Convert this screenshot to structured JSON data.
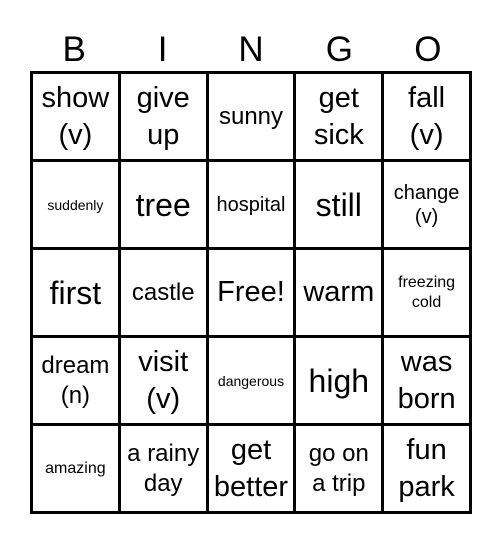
{
  "header": {
    "letters": [
      "B",
      "I",
      "N",
      "G",
      "O"
    ]
  },
  "cells": [
    {
      "text": "show\n(v)",
      "size": "s-lg"
    },
    {
      "text": "give\nup",
      "size": "s-lg"
    },
    {
      "text": "sunny",
      "size": "s-md"
    },
    {
      "text": "get\nsick",
      "size": "s-lg"
    },
    {
      "text": "fall\n(v)",
      "size": "s-lg"
    },
    {
      "text": "suddenly",
      "size": "s-xxs"
    },
    {
      "text": "tree",
      "size": "s-xl"
    },
    {
      "text": "hospital",
      "size": "s-sm"
    },
    {
      "text": "still",
      "size": "s-xl"
    },
    {
      "text": "change\n(v)",
      "size": "s-sm"
    },
    {
      "text": "first",
      "size": "s-xl"
    },
    {
      "text": "castle",
      "size": "s-md"
    },
    {
      "text": "Free!",
      "size": "s-lg"
    },
    {
      "text": "warm",
      "size": "s-lg"
    },
    {
      "text": "freezing\ncold",
      "size": "s-xs"
    },
    {
      "text": "dream\n(n)",
      "size": "s-md"
    },
    {
      "text": "visit\n(v)",
      "size": "s-lg"
    },
    {
      "text": "dangerous",
      "size": "s-xxs"
    },
    {
      "text": "high",
      "size": "s-xl"
    },
    {
      "text": "was\nborn",
      "size": "s-lg"
    },
    {
      "text": "amazing",
      "size": "s-xs"
    },
    {
      "text": "a rainy\nday",
      "size": "s-md"
    },
    {
      "text": "get\nbetter",
      "size": "s-lg"
    },
    {
      "text": "go on\na trip",
      "size": "s-md"
    },
    {
      "text": "fun\npark",
      "size": "s-lg"
    }
  ]
}
